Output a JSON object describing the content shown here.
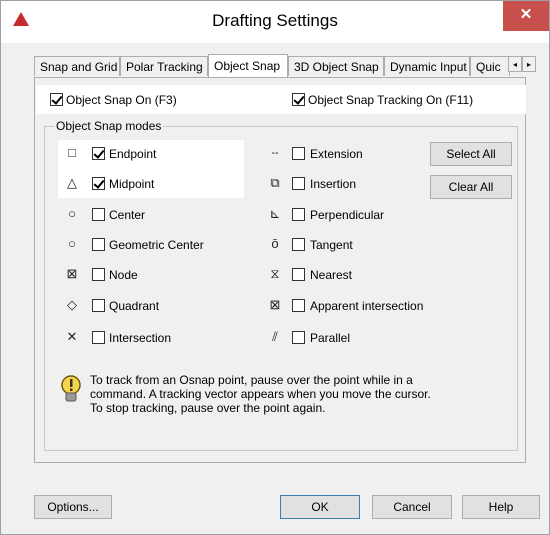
{
  "window": {
    "title": "Drafting Settings",
    "close_symbol": "✕"
  },
  "tabs": [
    {
      "label": "Snap and Grid",
      "active": false
    },
    {
      "label": "Polar Tracking",
      "active": false
    },
    {
      "label": "Object Snap",
      "active": true
    },
    {
      "label": "3D Object Snap",
      "active": false
    },
    {
      "label": "Dynamic Input",
      "active": false
    },
    {
      "label": "Quic",
      "active": false
    }
  ],
  "tab_scroll": {
    "left": "◂",
    "right": "▸"
  },
  "object_snap_on": {
    "label": "Object Snap On (F3)",
    "checked": true
  },
  "object_snap_tracking": {
    "label": "Object Snap Tracking On (F11)",
    "checked": true
  },
  "modes": {
    "group_title": "Object Snap modes",
    "left": [
      {
        "symbol": "□",
        "icon": "endpoint-icon",
        "label": "Endpoint",
        "checked": true
      },
      {
        "symbol": "△",
        "icon": "midpoint-icon",
        "label": "Midpoint",
        "checked": true
      },
      {
        "symbol": "○",
        "icon": "center-icon",
        "label": "Center",
        "checked": false
      },
      {
        "symbol": "○",
        "icon": "geometric-center-icon",
        "label": "Geometric Center",
        "checked": false
      },
      {
        "symbol": "⊠",
        "icon": "node-icon",
        "label": "Node",
        "checked": false
      },
      {
        "symbol": "◇",
        "icon": "quadrant-icon",
        "label": "Quadrant",
        "checked": false
      },
      {
        "symbol": "✕",
        "icon": "intersection-icon",
        "label": "Intersection",
        "checked": false
      }
    ],
    "right": [
      {
        "symbol": "--",
        "icon": "extension-icon",
        "label": "Extension",
        "checked": false
      },
      {
        "symbol": "⧉",
        "icon": "insertion-icon",
        "label": "Insertion",
        "checked": false
      },
      {
        "symbol": "⊾",
        "icon": "perpendicular-icon",
        "label": "Perpendicular",
        "checked": false
      },
      {
        "symbol": "ō",
        "icon": "tangent-icon",
        "label": "Tangent",
        "checked": false
      },
      {
        "symbol": "⧖",
        "icon": "nearest-icon",
        "label": "Nearest",
        "checked": false
      },
      {
        "symbol": "⊠",
        "icon": "apparent-intersection-icon",
        "label": "Apparent intersection",
        "checked": false
      },
      {
        "symbol": "⫽",
        "icon": "parallel-icon",
        "label": "Parallel",
        "checked": false
      }
    ],
    "select_all": "Select All",
    "clear_all": "Clear All"
  },
  "info": {
    "line1": "To track from an Osnap point, pause over the point while in a",
    "line2": "command.  A tracking vector appears when you move the cursor.",
    "line3": "To stop tracking, pause over the point again."
  },
  "footer": {
    "options": "Options...",
    "ok": "OK",
    "cancel": "Cancel",
    "help": "Help"
  },
  "colors": {
    "close": "#c7504c",
    "app_icon": "#c72b2b",
    "bulb": "#f5d44a"
  }
}
